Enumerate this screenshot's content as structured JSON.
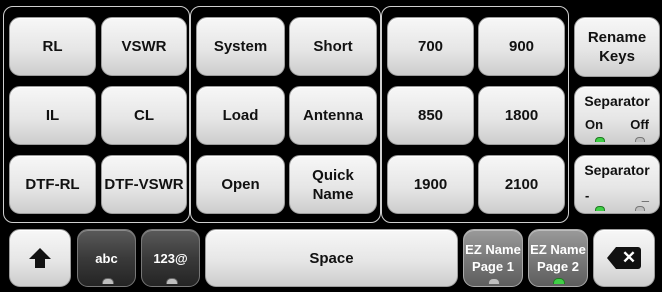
{
  "keyboard": {
    "group1": {
      "rows": [
        [
          "RL",
          "VSWR"
        ],
        [
          "IL",
          "CL"
        ],
        [
          "DTF-RL",
          "DTF-VSWR"
        ]
      ]
    },
    "group2": {
      "rows": [
        [
          "System",
          "Short"
        ],
        [
          "Load",
          "Antenna"
        ],
        [
          "Open",
          "Quick Name"
        ]
      ]
    },
    "group3": {
      "rows": [
        [
          "700",
          "900"
        ],
        [
          "850",
          "1800"
        ],
        [
          "1900",
          "2100"
        ]
      ]
    },
    "side": {
      "rename": [
        "Rename",
        "Keys"
      ],
      "separator1": {
        "title": "Separator",
        "options": [
          "On",
          "Off"
        ]
      },
      "separator2": {
        "title": "Separator",
        "options": [
          "-",
          "_"
        ]
      }
    },
    "bottom": {
      "shift_icon": "arrow-up-icon",
      "abc": "abc",
      "num": "123@",
      "space": "Space",
      "ez1": [
        "EZ Name",
        "Page 1"
      ],
      "ez2": [
        "EZ Name",
        "Page 2"
      ],
      "backspace_icon": "backspace-icon"
    },
    "colors": {
      "indicator_active": "#3fcf46",
      "indicator_inactive": "#bfbfbf",
      "background": "#000000"
    }
  }
}
